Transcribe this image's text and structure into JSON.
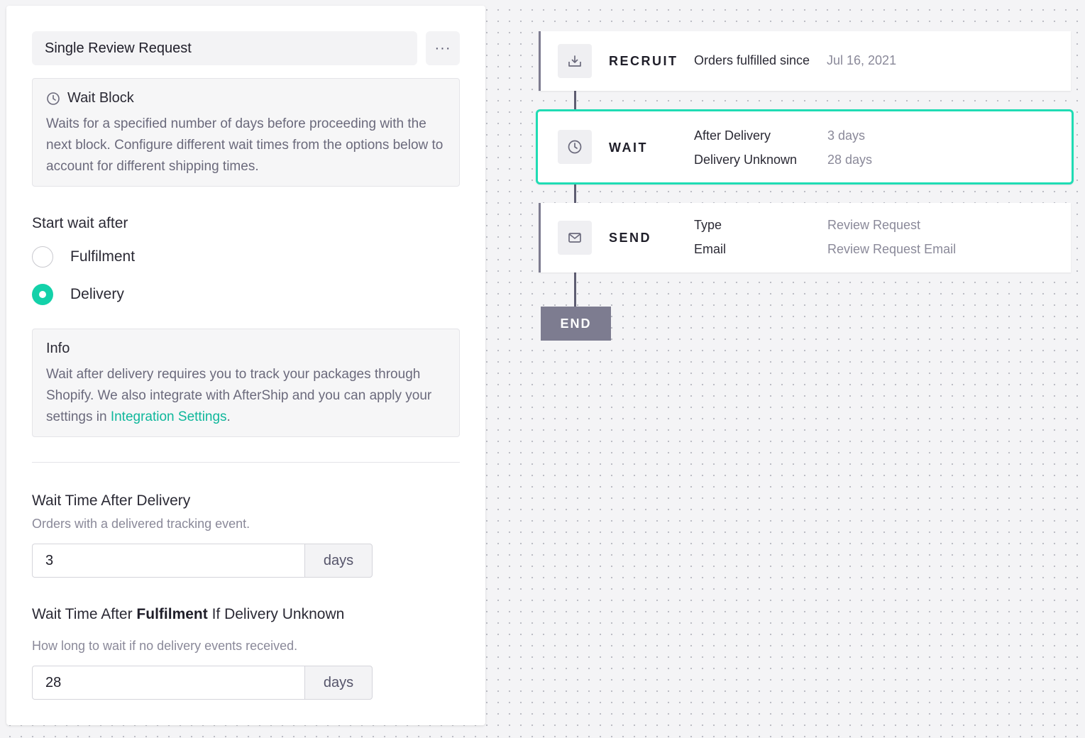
{
  "panel": {
    "title": "Single Review Request",
    "more_label": "···",
    "wait_block": {
      "icon": "clock-icon",
      "heading": "Wait Block",
      "description": "Waits for a specified number of days before proceeding with the next block. Configure different wait times from the options below to account for different shipping times."
    },
    "start_wait": {
      "label": "Start wait after",
      "options": [
        {
          "label": "Fulfilment",
          "selected": false
        },
        {
          "label": "Delivery",
          "selected": true
        }
      ]
    },
    "info": {
      "heading": "Info",
      "text_before": "Wait after delivery requires you to track your packages through Shopify. We also integrate with AfterShip and you can apply your settings in ",
      "link": "Integration Settings",
      "text_after": "."
    },
    "wait_after_delivery": {
      "label": "Wait Time After Delivery",
      "help": "Orders with a delivered tracking event.",
      "value": "3",
      "unit": "days"
    },
    "wait_after_fulfilment": {
      "label_prefix": "Wait Time After ",
      "label_bold": "Fulfilment",
      "label_suffix": " If Delivery Unknown",
      "help": "How long to wait if no delivery events received.",
      "value": "28",
      "unit": "days"
    }
  },
  "flow": {
    "recruit": {
      "icon": "inbox-download-icon",
      "name": "RECRUIT",
      "key": "Orders fulfilled since",
      "value": "Jul 16, 2021"
    },
    "wait": {
      "icon": "clock-icon",
      "name": "WAIT",
      "rows": [
        {
          "key": "After Delivery",
          "value": "3 days"
        },
        {
          "key": "Delivery Unknown",
          "value": "28 days"
        }
      ]
    },
    "send": {
      "icon": "mail-icon",
      "name": "SEND",
      "rows": [
        {
          "key": "Type",
          "value": "Review Request"
        },
        {
          "key": "Email",
          "value": "Review Request Email"
        }
      ]
    },
    "end_label": "END"
  },
  "colors": {
    "accent": "#13d1a9",
    "selected_border": "#1fdcb4",
    "connector": "#5e5d72",
    "end_block": "#7d7c90"
  }
}
